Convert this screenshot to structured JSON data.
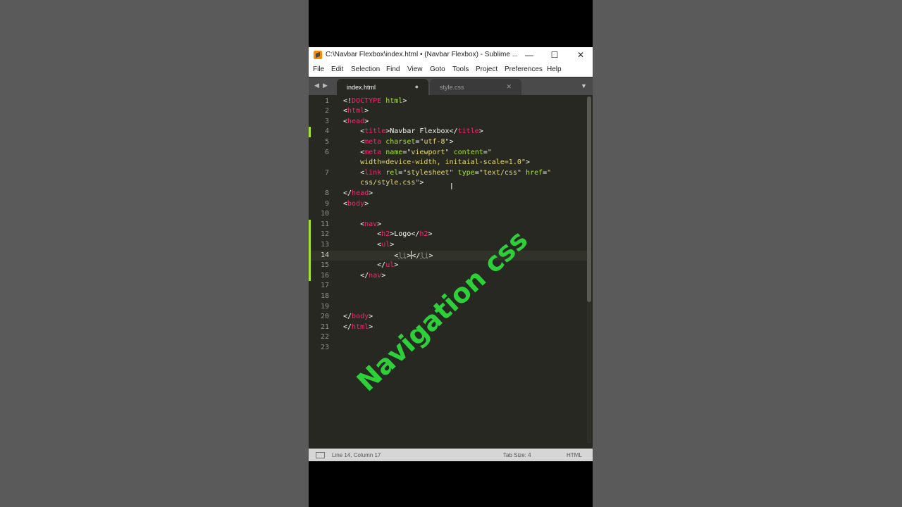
{
  "window": {
    "title": "C:\\Navbar Flexbox\\index.html • (Navbar Flexbox) - Sublime ...",
    "buttons": {
      "minimize": "—",
      "maximize": "☐",
      "close": "✕"
    }
  },
  "menu": [
    "File",
    "Edit",
    "Selection",
    "Find",
    "View",
    "Goto",
    "Tools",
    "Project",
    "Preferences",
    "Help"
  ],
  "tabs": [
    {
      "label": "index.html",
      "active": true,
      "modified_indicator": "●"
    },
    {
      "label": "style.css",
      "active": false,
      "close_glyph": "✕"
    }
  ],
  "tabbar": {
    "nav_left": "◀",
    "nav_right": "▶",
    "dropdown": "▼"
  },
  "editor": {
    "lines": [
      {
        "n": "1",
        "tokens": [
          [
            "p",
            "<!"
          ],
          [
            "t",
            "DOCTYPE"
          ],
          [
            "p",
            " "
          ],
          [
            "a",
            "html"
          ],
          [
            "p",
            ">"
          ]
        ]
      },
      {
        "n": "2",
        "tokens": [
          [
            "p",
            "<"
          ],
          [
            "t",
            "html"
          ],
          [
            "p",
            ">"
          ]
        ]
      },
      {
        "n": "3",
        "tokens": [
          [
            "p",
            "<"
          ],
          [
            "t",
            "head"
          ],
          [
            "p",
            ">"
          ]
        ]
      },
      {
        "n": "4",
        "tokens": [
          [
            "p",
            "    <"
          ],
          [
            "t",
            "title"
          ],
          [
            "p",
            ">Navbar Flexbox</"
          ],
          [
            "t",
            "title"
          ],
          [
            "p",
            ">"
          ]
        ]
      },
      {
        "n": "5",
        "tokens": [
          [
            "p",
            "    <"
          ],
          [
            "t",
            "meta"
          ],
          [
            "p",
            " "
          ],
          [
            "a",
            "charset"
          ],
          [
            "p",
            "="
          ],
          [
            "s",
            "\"utf-8\""
          ],
          [
            "p",
            ">"
          ]
        ]
      },
      {
        "n": "6",
        "tokens": [
          [
            "p",
            "    <"
          ],
          [
            "t",
            "meta"
          ],
          [
            "p",
            " "
          ],
          [
            "a",
            "name"
          ],
          [
            "p",
            "="
          ],
          [
            "s",
            "\"viewport\""
          ],
          [
            "p",
            " "
          ],
          [
            "a",
            "content"
          ],
          [
            "p",
            "="
          ],
          [
            "s",
            "\""
          ]
        ]
      },
      {
        "n": "",
        "tokens": [
          [
            "s",
            "    width=device-width, initaial-scale=1.0\""
          ],
          [
            "p",
            ">"
          ]
        ]
      },
      {
        "n": "7",
        "tokens": [
          [
            "p",
            "    <"
          ],
          [
            "t",
            "link"
          ],
          [
            "p",
            " "
          ],
          [
            "a",
            "rel"
          ],
          [
            "p",
            "="
          ],
          [
            "s",
            "\"stylesheet\""
          ],
          [
            "p",
            " "
          ],
          [
            "a",
            "type"
          ],
          [
            "p",
            "="
          ],
          [
            "s",
            "\"text/css\""
          ],
          [
            "p",
            " "
          ],
          [
            "a",
            "href"
          ],
          [
            "p",
            "="
          ],
          [
            "s",
            "\""
          ]
        ]
      },
      {
        "n": "",
        "tokens": [
          [
            "s",
            "    css/style.css\""
          ],
          [
            "p",
            ">"
          ]
        ]
      },
      {
        "n": "8",
        "tokens": [
          [
            "p",
            "</"
          ],
          [
            "t",
            "head"
          ],
          [
            "p",
            ">"
          ]
        ]
      },
      {
        "n": "9",
        "tokens": [
          [
            "p",
            "<"
          ],
          [
            "t",
            "body"
          ],
          [
            "p",
            ">"
          ]
        ]
      },
      {
        "n": "10",
        "tokens": []
      },
      {
        "n": "11",
        "tokens": [
          [
            "p",
            "    <"
          ],
          [
            "t",
            "nav"
          ],
          [
            "p",
            ">"
          ]
        ]
      },
      {
        "n": "12",
        "tokens": [
          [
            "p",
            "        <"
          ],
          [
            "t",
            "h2"
          ],
          [
            "p",
            ">Logo</"
          ],
          [
            "t",
            "h2"
          ],
          [
            "p",
            ">"
          ]
        ]
      },
      {
        "n": "13",
        "tokens": [
          [
            "p",
            "        <"
          ],
          [
            "t",
            "ul"
          ],
          [
            "p",
            ">"
          ]
        ]
      },
      {
        "n": "14",
        "current": true,
        "tokens": [
          [
            "p",
            "            <"
          ],
          [
            "m",
            "li"
          ],
          [
            "p",
            ">"
          ],
          [
            "caret",
            ""
          ],
          [
            "p",
            "</"
          ],
          [
            "m",
            "li"
          ],
          [
            "p",
            ">"
          ]
        ]
      },
      {
        "n": "15",
        "tokens": [
          [
            "p",
            "        </"
          ],
          [
            "t",
            "ul"
          ],
          [
            "p",
            ">"
          ]
        ]
      },
      {
        "n": "16",
        "tokens": [
          [
            "p",
            "    </"
          ],
          [
            "t",
            "nav"
          ],
          [
            "p",
            ">"
          ]
        ]
      },
      {
        "n": "17",
        "tokens": []
      },
      {
        "n": "18",
        "tokens": []
      },
      {
        "n": "19",
        "tokens": []
      },
      {
        "n": "20",
        "tokens": [
          [
            "p",
            "</"
          ],
          [
            "t",
            "body"
          ],
          [
            "p",
            ">"
          ]
        ]
      },
      {
        "n": "21",
        "tokens": [
          [
            "p",
            "</"
          ],
          [
            "t",
            "html"
          ],
          [
            "p",
            ">"
          ]
        ]
      },
      {
        "n": "22",
        "tokens": []
      },
      {
        "n": "23",
        "tokens": []
      }
    ],
    "colors": {
      "background": "#272822",
      "tag": "#f92672",
      "attribute": "#a6e22e",
      "string": "#e6db74",
      "text": "#f8f8f2",
      "gutter": "#8f908a"
    }
  },
  "statusbar": {
    "position": "Line 14, Column 17",
    "tab_size": "Tab Size: 4",
    "syntax": "HTML"
  },
  "overlay_text": "Navigation css",
  "overlay_color": "#2ed03a"
}
